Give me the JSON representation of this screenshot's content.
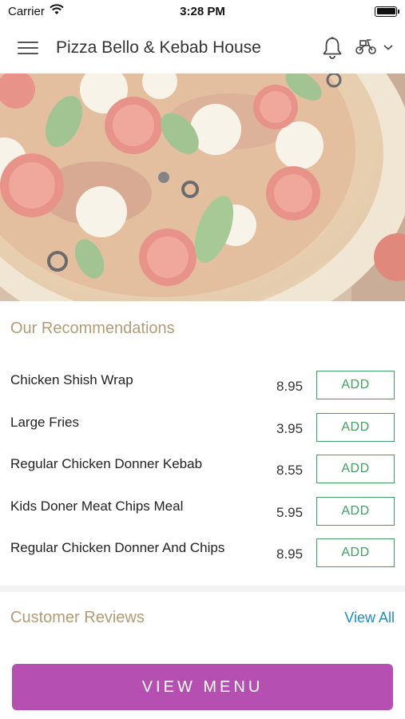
{
  "status_bar": {
    "carrier": "Carrier",
    "time": "3:28 PM"
  },
  "header": {
    "title": "Pizza Bello & Kebab House"
  },
  "hero": {
    "image_alt": "pizza-photo"
  },
  "recommendations": {
    "title": "Our Recommendations",
    "items": [
      {
        "name": "Chicken Shish Wrap",
        "price": "8.95",
        "button": "ADD"
      },
      {
        "name": "Large Fries",
        "price": "3.95",
        "button": "ADD"
      },
      {
        "name": "Regular Chicken Donner Kebab",
        "price": "8.55",
        "button": "ADD"
      },
      {
        "name": "Kids Doner Meat Chips Meal",
        "price": "5.95",
        "button": "ADD"
      },
      {
        "name": "Regular Chicken Donner And Chips",
        "price": "8.95",
        "button": "ADD"
      }
    ]
  },
  "reviews": {
    "title": "Customer Reviews",
    "view_all": "View All"
  },
  "footer": {
    "view_menu": "VIEW MENU"
  },
  "colors": {
    "accent_gold": "#b39b74",
    "add_green": "#3fa060",
    "link_blue": "#1a8fc9",
    "view_menu_purple": "#b54fb1"
  },
  "icons": [
    "wifi-icon",
    "battery-icon",
    "hamburger-menu-icon",
    "bell-icon",
    "scooter-icon",
    "chevron-down-icon"
  ]
}
